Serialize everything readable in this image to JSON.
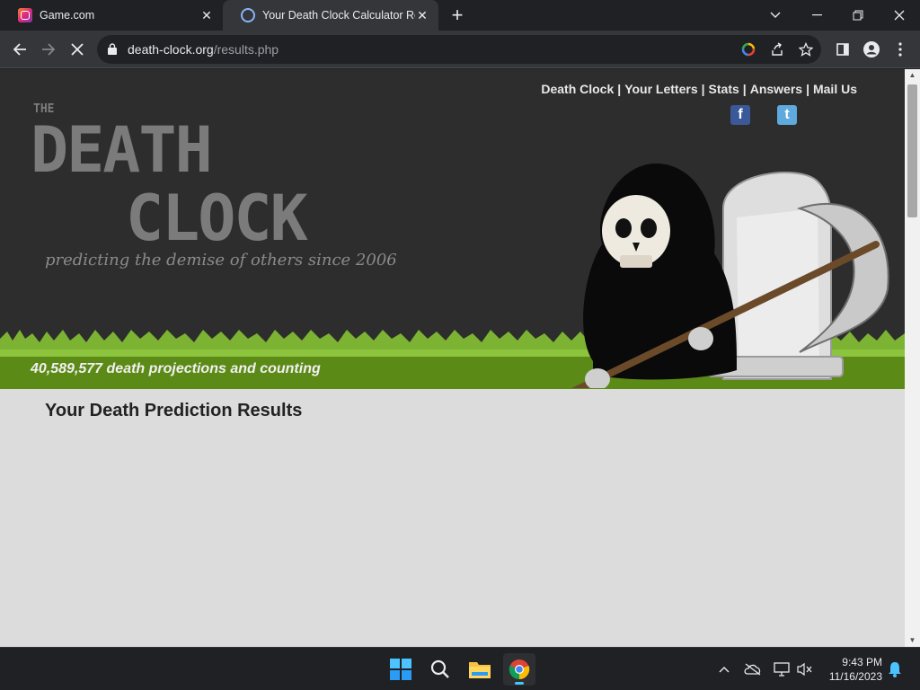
{
  "browser": {
    "tabs": [
      {
        "title": "Game.com",
        "active": false
      },
      {
        "title": "Your Death Clock Calculator Resu",
        "active": true
      }
    ],
    "new_tab": "+",
    "address": {
      "domain": "death-clock.org",
      "path": "/results.php"
    }
  },
  "site": {
    "nav": [
      "Death Clock",
      "Your Letters",
      "Stats",
      "Answers",
      "Mail Us"
    ],
    "nav_separator": "|",
    "logo": {
      "the": "THE",
      "death": "DEATH",
      "clock": "CLOCK",
      "tagline": "predicting the demise of others since 2006"
    },
    "counter": "40,589,577 death projections and counting",
    "social": {
      "facebook": "f",
      "twitter": "t"
    }
  },
  "page": {
    "heading": "Your Death Prediction Results"
  },
  "taskbar": {
    "time": "9:43 PM",
    "date": "11/16/2023"
  },
  "colors": {
    "header_bg": "#2d2d2d",
    "grass": "#5c8a16",
    "content_bg": "#dddcdc",
    "accent_blue": "#4cc2ff"
  }
}
